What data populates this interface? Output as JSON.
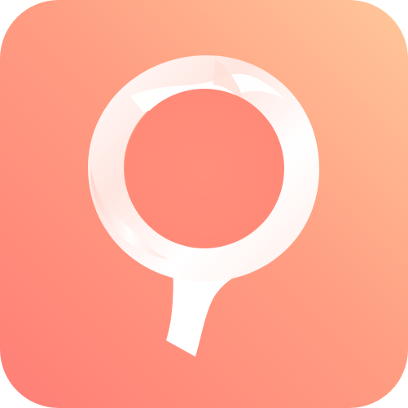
{
  "app_icon": {
    "icon": "q-ribbon-logo-icon",
    "colors": {
      "background_top_right": "#FFC79A",
      "background_mid": "#FF9E82",
      "background_bottom_left": "#FF7E76",
      "inner_circle": "#FF8A78",
      "ribbon_light": "#FFFFFF",
      "ribbon_shade": "#FFD9D2"
    }
  }
}
